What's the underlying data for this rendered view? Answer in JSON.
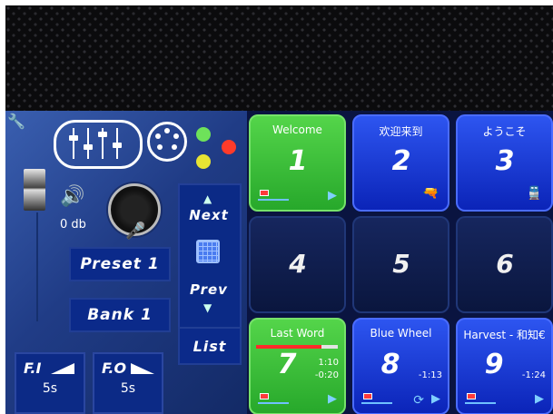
{
  "volume_label": "0 db",
  "preset_label": "Preset 1",
  "bank_label": "Bank 1",
  "nav": {
    "next": "Next",
    "prev": "Prev",
    "list": "List"
  },
  "fade_in": {
    "label": "F.I",
    "value": "5s"
  },
  "fade_out": {
    "label": "F.O",
    "value": "5s"
  },
  "leds": {
    "green": "#6ee25a",
    "red": "#ff3b2a",
    "yellow": "#e7e433"
  },
  "pads": [
    {
      "title": "Welcome",
      "number": "1",
      "state": "green"
    },
    {
      "title": "欢迎来到",
      "number": "2",
      "state": "blue",
      "icon": "gun-icon"
    },
    {
      "title": "ようこそ",
      "number": "3",
      "state": "blue",
      "icon": "train-icon"
    },
    {
      "title": "",
      "number": "4",
      "state": "empty"
    },
    {
      "title": "",
      "number": "5",
      "state": "empty"
    },
    {
      "title": "",
      "number": "6",
      "state": "empty"
    },
    {
      "title": "Last Word",
      "number": "7",
      "state": "green",
      "time_total": "1:10",
      "time_remaining": "-0:20",
      "progress": 0.8
    },
    {
      "title": "Blue Wheel",
      "number": "8",
      "state": "blue",
      "time_remaining": "-1:13"
    },
    {
      "title": "Harvest - 和知€",
      "number": "9",
      "state": "blue",
      "time_remaining": "-1:24"
    }
  ]
}
